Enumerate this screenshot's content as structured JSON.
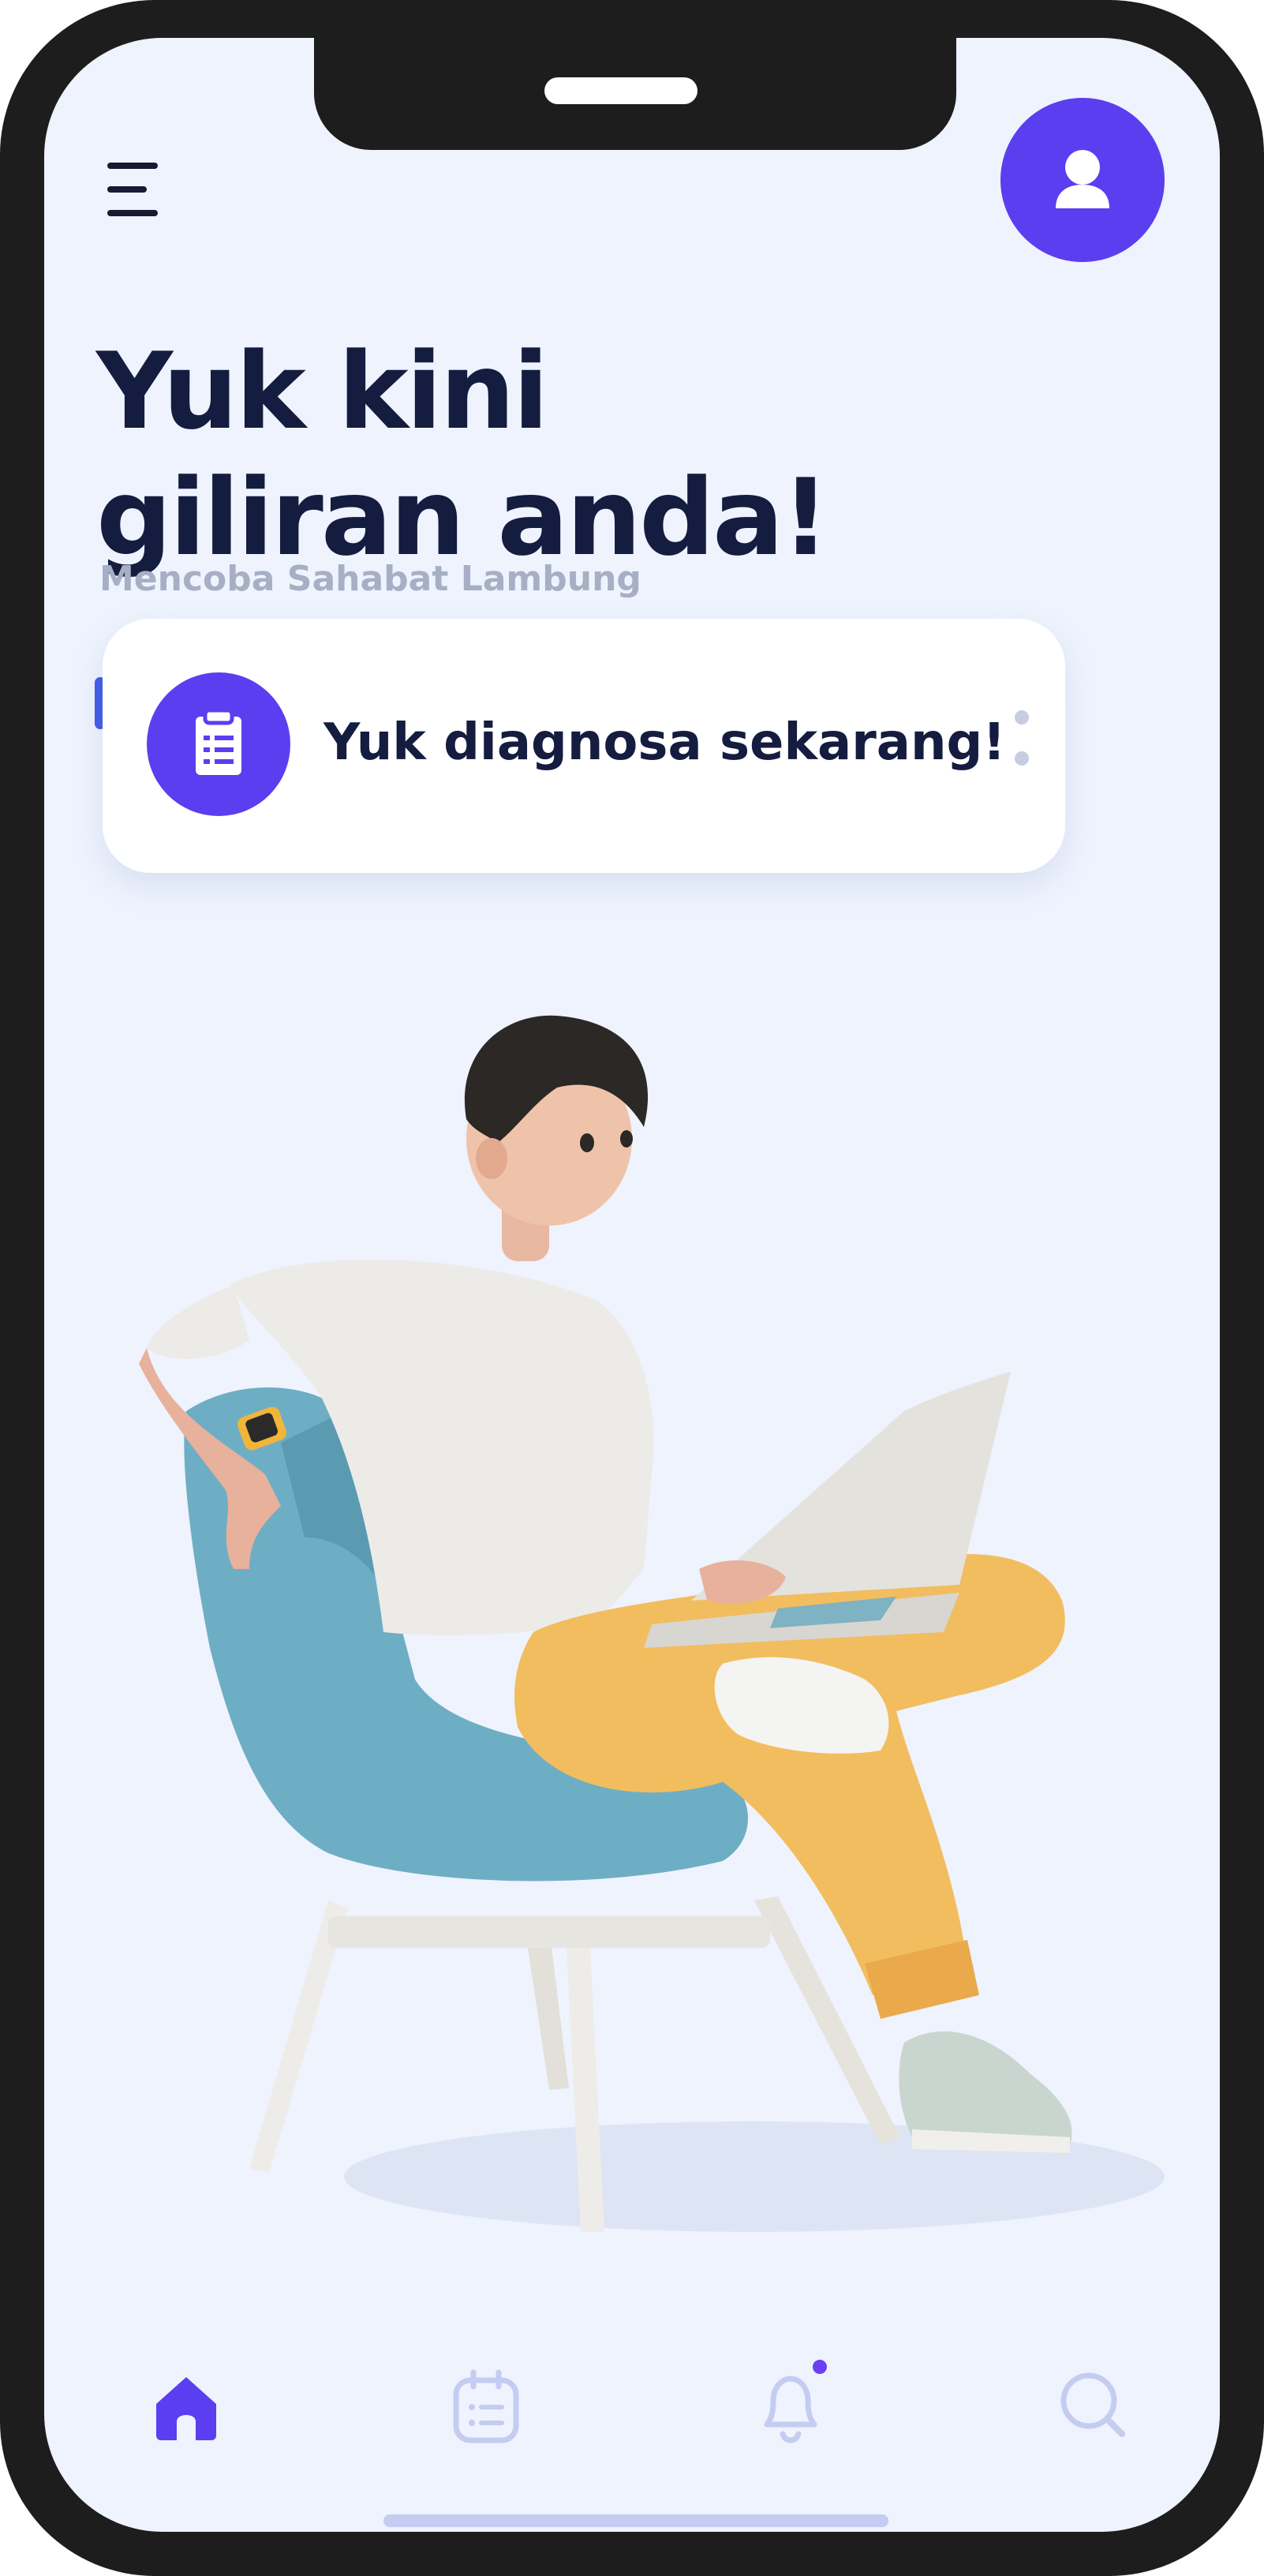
{
  "header": {
    "menu_icon": "menu-icon",
    "profile_icon": "user-icon"
  },
  "hero": {
    "title_line1": "Yuk kini",
    "title_line2": "giliran anda!",
    "subtitle": "Mencoba Sahabat Lambung"
  },
  "cta_card": {
    "icon": "clipboard-list-icon",
    "label": "Yuk diagnosa sekarang!",
    "more_icon": "more-vertical-icon"
  },
  "tabbar": {
    "items": [
      {
        "name": "home",
        "icon": "home-icon",
        "active": true
      },
      {
        "name": "calendar",
        "icon": "calendar-icon",
        "active": false
      },
      {
        "name": "notifications",
        "icon": "bell-icon",
        "active": false,
        "has_badge": true
      },
      {
        "name": "search",
        "icon": "search-icon",
        "active": false
      }
    ]
  },
  "colors": {
    "primary": "#5b3ef0",
    "title": "#141c3f",
    "subtitle": "#a7afc4",
    "background": "#eef3fd",
    "tab_inactive": "#c4ccf1"
  }
}
